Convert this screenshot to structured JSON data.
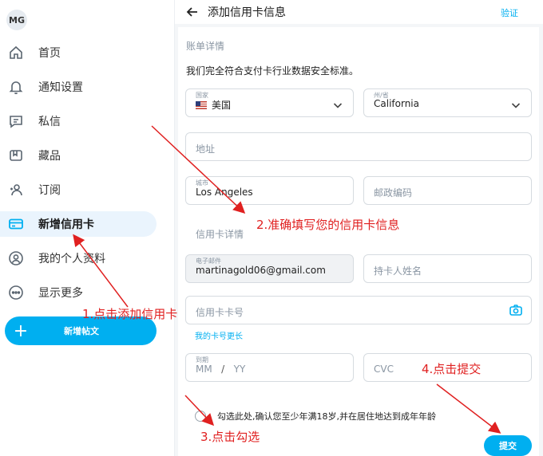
{
  "sidebar": {
    "avatar_initials": "MG",
    "items": [
      {
        "label": "首页",
        "icon": "home-icon"
      },
      {
        "label": "通知设置",
        "icon": "bell-icon"
      },
      {
        "label": "私信",
        "icon": "message-icon"
      },
      {
        "label": "藏品",
        "icon": "bookmark-icon"
      },
      {
        "label": "订阅",
        "icon": "subscriptions-icon"
      },
      {
        "label": "新增信用卡",
        "icon": "credit-card-icon",
        "active": true
      },
      {
        "label": "我的个人资料",
        "icon": "profile-icon"
      },
      {
        "label": "显示更多",
        "icon": "more-icon"
      }
    ],
    "post_button": "新增帖文"
  },
  "header": {
    "title": "添加信用卡信息",
    "verify": "验证"
  },
  "billing": {
    "section_title": "账单详情",
    "note": "我们完全符合支付卡行业数据安全标准。",
    "country_label": "国家",
    "country_value": "美国",
    "state_label": "州/省",
    "state_value": "California",
    "address_placeholder": "地址",
    "city_label": "城市",
    "city_value": "Los Angeles",
    "zip_placeholder": "邮政编码"
  },
  "card": {
    "section_title": "信用卡详情",
    "email_label": "电子邮件",
    "email_value": "martinagold06@gmail.com",
    "holder_placeholder": "持卡人姓名",
    "number_placeholder": "信用卡卡号",
    "longer_link": "我的卡号更长",
    "expiry_label": "到期",
    "expiry_mm": "MM",
    "expiry_sep": "/",
    "expiry_yy": "YY",
    "cvc_placeholder": "CVC",
    "consent": "勾选此处,确认您至少年满18岁,并在居住地达到成年年龄",
    "submit": "提交"
  },
  "annotations": {
    "step1": "1.点击添加信用卡",
    "step2": "2.准确填写您的信用卡信息",
    "step3": "3.点击勾选",
    "step4": "4.点击提交"
  },
  "colors": {
    "accent": "#00aff0",
    "annotation": "#e02020"
  }
}
